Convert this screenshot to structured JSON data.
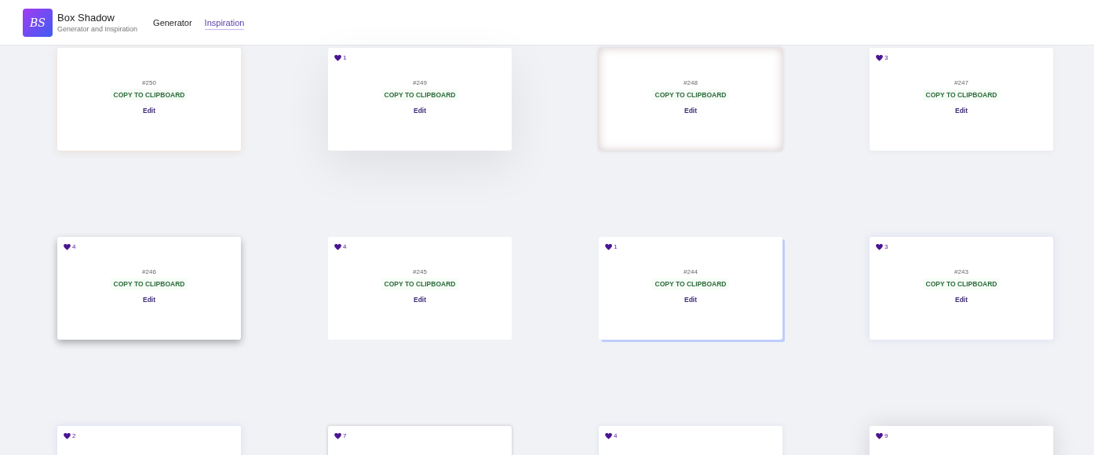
{
  "brand": {
    "logo": "BS",
    "title": "Box Shadow",
    "subtitle": "Generator and Inspiration"
  },
  "nav": [
    {
      "label": "Generator",
      "selected": false
    },
    {
      "label": "Inspiration",
      "selected": true
    }
  ],
  "cards": [
    {
      "number": "#250",
      "copy": "COPY TO CLIPBOARD",
      "edit": "Edit"
    },
    {
      "likes": "1",
      "number": "#249",
      "copy": "COPY TO CLIPBOARD",
      "edit": "Edit"
    },
    {
      "number": "#248",
      "copy": "COPY TO CLIPBOARD",
      "edit": "Edit"
    },
    {
      "likes": "3",
      "number": "#247",
      "copy": "COPY TO CLIPBOARD",
      "edit": "Edit"
    },
    {
      "likes": "4",
      "number": "#246",
      "copy": "COPY TO CLIPBOARD",
      "edit": "Edit"
    },
    {
      "likes": "4",
      "number": "#245",
      "copy": "COPY TO CLIPBOARD",
      "edit": "Edit"
    },
    {
      "likes": "1",
      "number": "#244",
      "copy": "COPY TO CLIPBOARD",
      "edit": "Edit"
    },
    {
      "likes": "3",
      "number": "#243",
      "copy": "COPY TO CLIPBOARD",
      "edit": "Edit"
    },
    {
      "likes": "2"
    },
    {
      "likes": "7"
    },
    {
      "likes": "4"
    },
    {
      "likes": "9"
    }
  ]
}
